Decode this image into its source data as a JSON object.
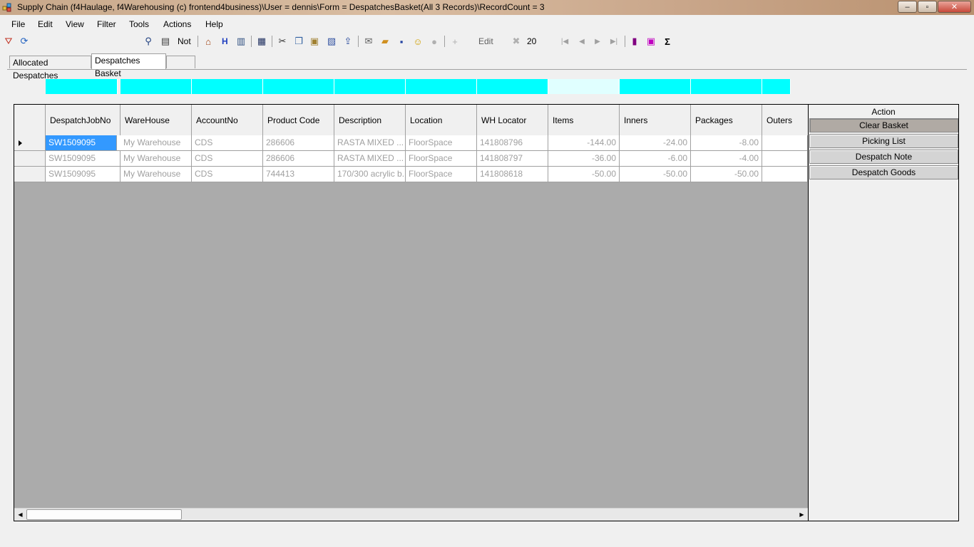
{
  "window": {
    "title": "Supply Chain (f4Haulage, f4Warehousing (c) frontend4business)\\User = dennis\\Form = DespatchesBasket(All 3 Records)\\RecordCount = 3",
    "controls": {
      "minimize": "–",
      "maximize": "▫",
      "close": "✕"
    }
  },
  "menu": [
    "File",
    "Edit",
    "View",
    "Filter",
    "Tools",
    "Actions",
    "Help"
  ],
  "toolbar": {
    "not_label": "Not",
    "h_label": "H",
    "edit_label": "Edit",
    "page_size": "20",
    "plus": "+",
    "sigma": "Σ",
    "icons": [
      "filter-clear-icon",
      "refresh-icon",
      "search-icon",
      "find-replace-icon",
      "home-icon",
      "book-icon",
      "calculator-icon",
      "cut-icon",
      "copy-icon",
      "paste-icon",
      "paste-special-icon",
      "export-icon",
      "email-icon",
      "open-folder-icon",
      "save-icon",
      "smiley-icon",
      "circle-icon",
      "add-icon",
      "delete-icon",
      "first-record-icon",
      "prev-record-icon",
      "next-record-icon",
      "last-record-icon",
      "chart-icon",
      "preview-icon",
      "sum-icon"
    ]
  },
  "tabs": [
    "Allocated Despatches",
    "Despatches Basket",
    ""
  ],
  "grid": {
    "columns": [
      "DespatchJobNo",
      "WareHouse",
      "AccountNo",
      "Product Code",
      "Description",
      "Location",
      "WH Locator",
      "Items",
      "Inners",
      "Packages",
      "Outers"
    ],
    "rows": [
      [
        "SW1509095",
        "My Warehouse",
        "CDS",
        "286606",
        "RASTA MIXED ...",
        "FloorSpace",
        "141808796",
        "-144.00",
        "-24.00",
        "-8.00",
        ""
      ],
      [
        "SW1509095",
        "My Warehouse",
        "CDS",
        "286606",
        "RASTA MIXED ...",
        "FloorSpace",
        "141808797",
        "-36.00",
        "-6.00",
        "-4.00",
        ""
      ],
      [
        "SW1509095",
        "My Warehouse",
        "CDS",
        "744413",
        "170/300 acrylic b...",
        "FloorSpace",
        "141808618",
        "-50.00",
        "-50.00",
        "-50.00",
        ""
      ]
    ]
  },
  "actions": {
    "title": "Action",
    "buttons": [
      "Clear Basket",
      "Picking List",
      "Despatch Note",
      "Despatch Goods"
    ]
  },
  "colors": {
    "filter_strip": "#00ffff",
    "selection": "#3399ff",
    "grid_empty": "#ababab"
  }
}
